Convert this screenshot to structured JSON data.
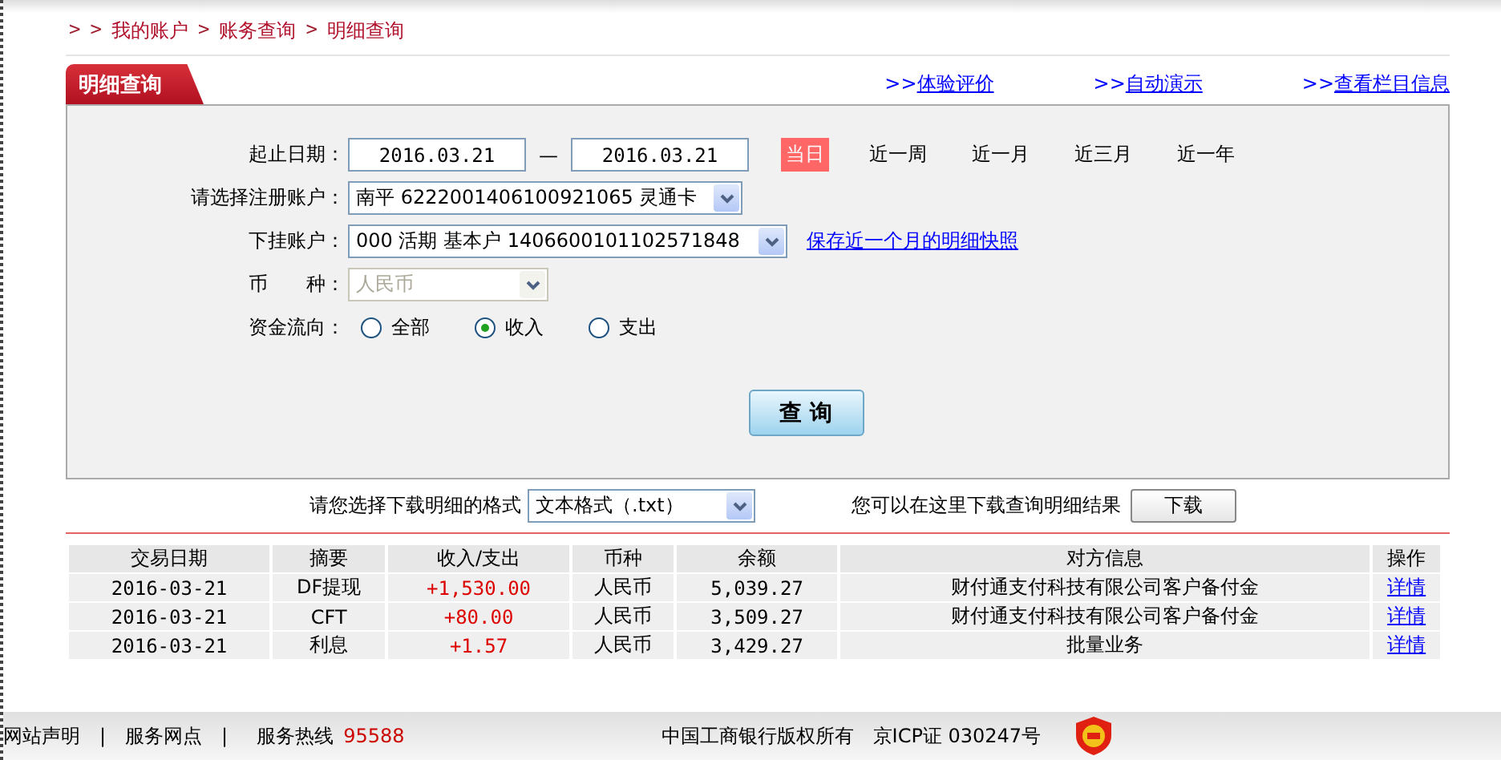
{
  "breadcrumb": [
    {
      "kind": "sep",
      "text": ">"
    },
    {
      "kind": "sep",
      "text": ">"
    },
    {
      "kind": "link",
      "text": "我的账户"
    },
    {
      "kind": "sep",
      "text": ">"
    },
    {
      "kind": "link",
      "text": "账务查询"
    },
    {
      "kind": "sep",
      "text": ">"
    },
    {
      "kind": "link",
      "text": "明细查询"
    }
  ],
  "tab": {
    "label": "明细查询"
  },
  "header_links": [
    {
      "prefix": ">>",
      "label": "体验评价"
    },
    {
      "prefix": ">>",
      "label": "自动演示"
    },
    {
      "prefix": ">>",
      "label": "查看栏目信息"
    }
  ],
  "form": {
    "date_label": "起止日期：",
    "start_date": "2016.03.21",
    "dash": "—",
    "end_date": "2016.03.21",
    "ranges": [
      {
        "label": "当日",
        "selected": true
      },
      {
        "label": "近一周",
        "selected": false
      },
      {
        "label": "近一月",
        "selected": false
      },
      {
        "label": "近三月",
        "selected": false
      },
      {
        "label": "近一年",
        "selected": false
      }
    ],
    "account_label": "请选择注册账户：",
    "account_value": "南平  6222001406100921065 灵通卡",
    "sub_label": "下挂账户：",
    "sub_value": "000 活期 基本户 1406600101102571848",
    "save_link": "保存近一个月的明细快照",
    "currency_label": "币　　种：",
    "currency_value": "人民币",
    "currency_disabled": true,
    "flow_label": "资金流向：",
    "flow_options": [
      {
        "label": "全部",
        "selected": false
      },
      {
        "label": "收入",
        "selected": true
      },
      {
        "label": "支出",
        "selected": false
      }
    ],
    "query_button": "查 询"
  },
  "download": {
    "label": "请您选择下载明细的格式",
    "format": "文本格式（.txt）",
    "hint": "您可以在这里下载查询明细结果",
    "button": "下载"
  },
  "table": {
    "columns": [
      "交易日期",
      "摘要",
      "收入/支出",
      "币种",
      "余额",
      "对方信息",
      "操作"
    ],
    "rows": [
      [
        "2016-03-21",
        "DF提现",
        "+1,530.00",
        "人民币",
        "5,039.27",
        "财付通支付科技有限公司客户备付金",
        "详情"
      ],
      [
        "2016-03-21",
        "CFT",
        "+80.00",
        "人民币",
        "3,509.27",
        "财付通支付科技有限公司客户备付金",
        "详情"
      ],
      [
        "2016-03-21",
        "利息",
        "+1.57",
        "人民币",
        "3,429.27",
        "批量业务",
        "详情"
      ]
    ]
  },
  "footer": {
    "links": [
      "网站声明",
      "服务网点"
    ],
    "divider": "|",
    "hotline_label": "服务热线",
    "hotline": "95588",
    "copyright": "中国工商银行版权所有",
    "icp": "京ICP证 030247号"
  }
}
